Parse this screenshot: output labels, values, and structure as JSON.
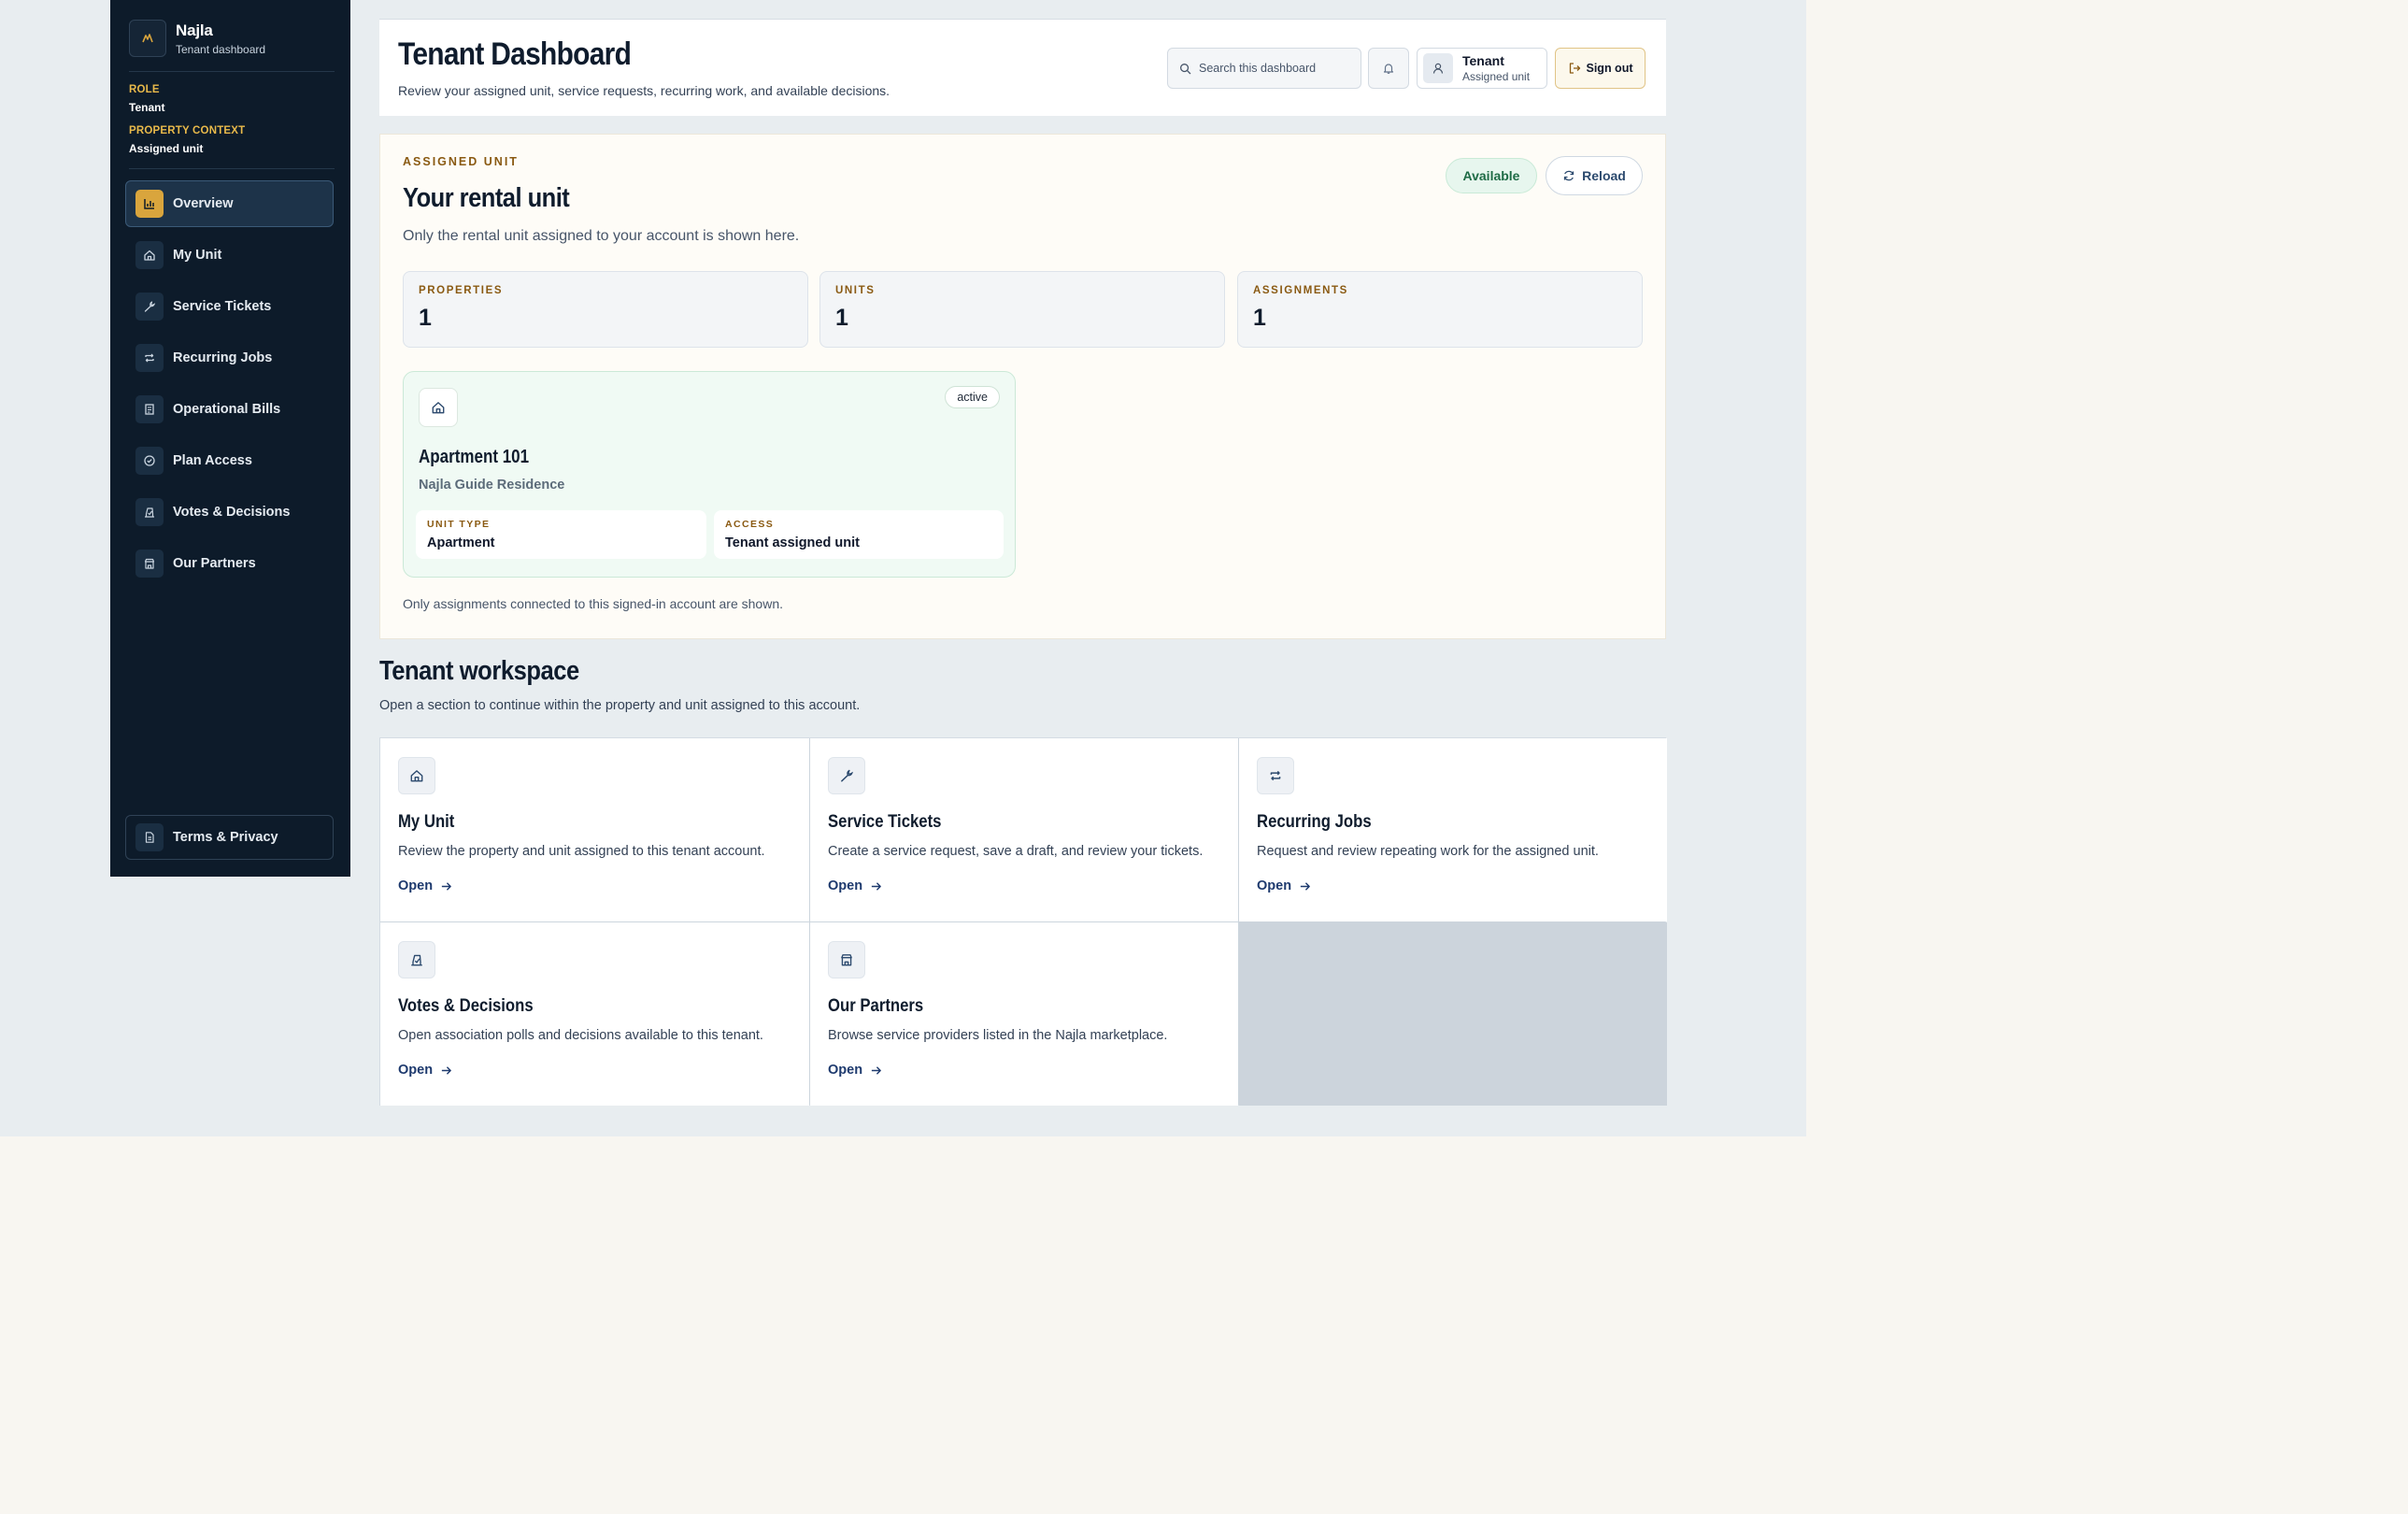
{
  "brand": {
    "name": "Najla",
    "subtitle": "Tenant dashboard"
  },
  "context": {
    "role_label": "ROLE",
    "role_value": "Tenant",
    "property_label": "PROPERTY CONTEXT",
    "property_value": "Assigned unit"
  },
  "sidebar": {
    "items": [
      {
        "label": "Overview",
        "icon": "chart-icon",
        "active": true
      },
      {
        "label": "My Unit",
        "icon": "home-icon"
      },
      {
        "label": "Service Tickets",
        "icon": "wrench-icon"
      },
      {
        "label": "Recurring Jobs",
        "icon": "repeat-icon"
      },
      {
        "label": "Operational Bills",
        "icon": "receipt-icon"
      },
      {
        "label": "Plan Access",
        "icon": "check-circle-icon"
      },
      {
        "label": "Votes & Decisions",
        "icon": "ballot-icon"
      },
      {
        "label": "Our Partners",
        "icon": "store-icon"
      }
    ],
    "footer_label": "Terms & Privacy"
  },
  "header": {
    "title": "Tenant Dashboard",
    "subtitle": "Review your assigned unit, service requests, recurring work, and available decisions.",
    "search_placeholder": "Search this dashboard",
    "user_name": "Tenant",
    "user_sub": "Assigned unit",
    "signout_label": "Sign out"
  },
  "unit": {
    "eyebrow": "ASSIGNED UNIT",
    "title": "Your rental unit",
    "description": "Only the rental unit assigned to your account is shown here.",
    "status_badge": "Available",
    "reload_label": "Reload",
    "stats": [
      {
        "label": "PROPERTIES",
        "value": "1"
      },
      {
        "label": "UNITS",
        "value": "1"
      },
      {
        "label": "ASSIGNMENTS",
        "value": "1"
      }
    ],
    "apartment": {
      "status": "active",
      "name": "Apartment 101",
      "residence": "Najla Guide Residence",
      "type_label": "UNIT TYPE",
      "type_value": "Apartment",
      "access_label": "ACCESS",
      "access_value": "Tenant assigned unit"
    },
    "footnote": "Only assignments connected to this signed-in account are shown."
  },
  "workspace": {
    "title": "Tenant workspace",
    "subtitle": "Open a section to continue within the property and unit assigned to this account.",
    "open_label": "Open",
    "tiles": [
      {
        "title": "My Unit",
        "desc": "Review the property and unit assigned to this tenant account."
      },
      {
        "title": "Service Tickets",
        "desc": "Create a service request, save a draft, and review your tickets."
      },
      {
        "title": "Recurring Jobs",
        "desc": "Request and review repeating work for the assigned unit."
      },
      {
        "title": "Votes & Decisions",
        "desc": "Open association polls and decisions available to this tenant."
      },
      {
        "title": "Our Partners",
        "desc": "Browse service providers listed in the Najla marketplace."
      }
    ]
  },
  "colors": {
    "sidebar_bg": "#0d1b2a",
    "accent_gold": "#d9a53d",
    "available_green": "#1e6b45",
    "link_navy": "#1e3a6e"
  }
}
